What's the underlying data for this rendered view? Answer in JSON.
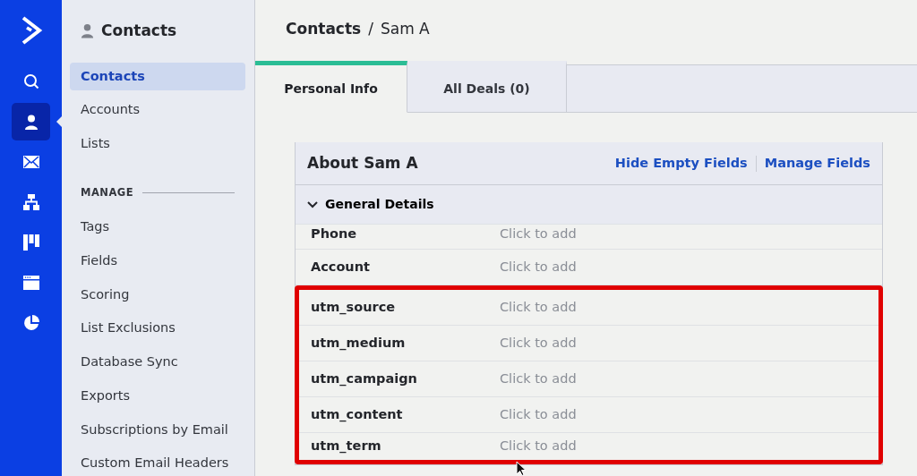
{
  "rail": {
    "items": [
      {
        "kind": "logo",
        "selected": false
      },
      {
        "kind": "search",
        "selected": false
      },
      {
        "kind": "contacts",
        "selected": true
      },
      {
        "kind": "mail",
        "selected": false
      },
      {
        "kind": "automation",
        "selected": false
      },
      {
        "kind": "board",
        "selected": false
      },
      {
        "kind": "page",
        "selected": false
      },
      {
        "kind": "pie",
        "selected": false
      }
    ]
  },
  "sidebar": {
    "title": "Contacts",
    "items": [
      {
        "kind": "link",
        "label": "Contacts",
        "selected": true
      },
      {
        "kind": "link",
        "label": "Accounts",
        "selected": false
      },
      {
        "kind": "link",
        "label": "Lists",
        "selected": false
      },
      {
        "kind": "header",
        "label": "MANAGE"
      },
      {
        "kind": "link",
        "label": "Tags",
        "selected": false
      },
      {
        "kind": "link",
        "label": "Fields",
        "selected": false
      },
      {
        "kind": "link",
        "label": "Scoring",
        "selected": false
      },
      {
        "kind": "link",
        "label": "List Exclusions",
        "selected": false
      },
      {
        "kind": "link",
        "label": "Database Sync",
        "selected": false
      },
      {
        "kind": "link",
        "label": "Exports",
        "selected": false
      },
      {
        "kind": "link",
        "label": "Subscriptions by Email",
        "selected": false
      },
      {
        "kind": "link",
        "label": "Custom Email Headers",
        "selected": false
      }
    ]
  },
  "breadcrumb": {
    "parent": "Contacts",
    "separator": "/",
    "current": "Sam A"
  },
  "tabs": [
    {
      "label": "Personal Info",
      "selected": true
    },
    {
      "label": "All Deals (0)",
      "selected": false
    }
  ],
  "card": {
    "title": "About Sam A",
    "links": [
      "Hide Empty Fields",
      "Manage Fields"
    ],
    "section": {
      "label": "General Details",
      "expanded": true
    },
    "fields": [
      {
        "label": "Phone",
        "placeholder": "Click to add",
        "highlighted": false
      },
      {
        "label": "Account",
        "placeholder": "Click to add",
        "highlighted": false
      },
      {
        "label": "utm_source",
        "placeholder": "Click to add",
        "highlighted": true
      },
      {
        "label": "utm_medium",
        "placeholder": "Click to add",
        "highlighted": true
      },
      {
        "label": "utm_campaign",
        "placeholder": "Click to add",
        "highlighted": true
      },
      {
        "label": "utm_content",
        "placeholder": "Click to add",
        "highlighted": true
      },
      {
        "label": "utm_term",
        "placeholder": "Click to add",
        "highlighted": true
      }
    ]
  }
}
